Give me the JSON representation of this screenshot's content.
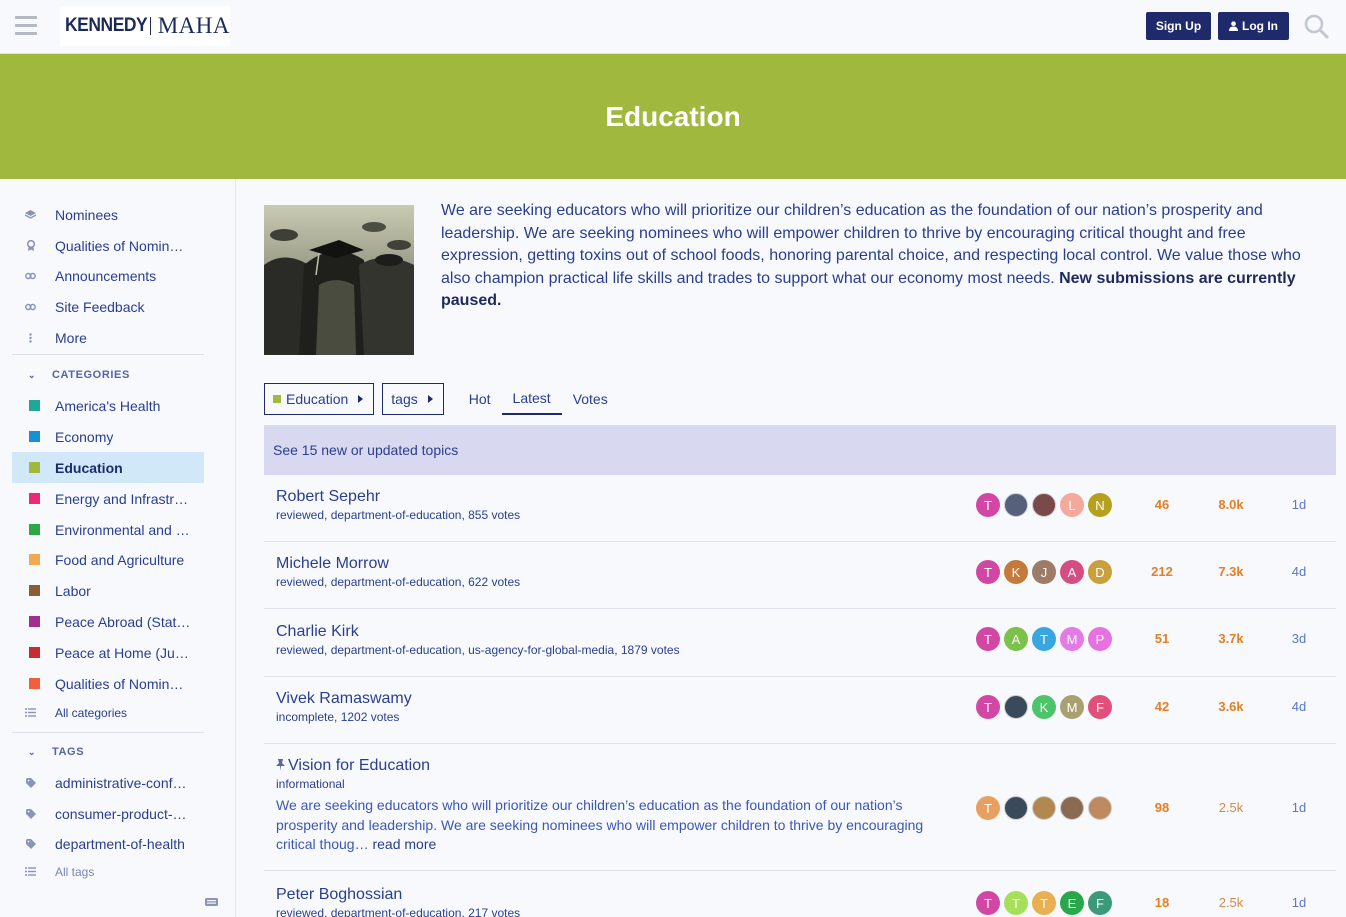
{
  "header": {
    "logo_left": "KENNEDY",
    "logo_right": "MAHA",
    "signup_label": "Sign Up",
    "login_label": "Log In"
  },
  "banner": {
    "title": "Education"
  },
  "sidebar": {
    "top_items": [
      {
        "label": "Nominees",
        "icon": "layers-icon"
      },
      {
        "label": "Qualities of Nominees",
        "icon": "award-icon"
      },
      {
        "label": "Announcements",
        "icon": "link-icon"
      },
      {
        "label": "Site Feedback",
        "icon": "link-icon"
      },
      {
        "label": "More",
        "icon": "ellipsis-icon"
      }
    ],
    "categories_heading": "CATEGORIES",
    "categories": [
      {
        "label": "America's Health",
        "color": "#1fa89a"
      },
      {
        "label": "Economy",
        "color": "#1a8fd4"
      },
      {
        "label": "Education",
        "color": "#a0b83e"
      },
      {
        "label": "Energy and Infrastructure",
        "color": "#ec2a77"
      },
      {
        "label": "Environmental and Natural Resources",
        "color": "#2aa84a"
      },
      {
        "label": "Food and Agriculture",
        "color": "#f2a954"
      },
      {
        "label": "Labor",
        "color": "#8a5e35"
      },
      {
        "label": "Peace Abroad (State, Defense)",
        "color": "#a0308e"
      },
      {
        "label": "Peace at Home (Justice, Homeland)",
        "color": "#c22e34"
      },
      {
        "label": "Qualities of Nominees",
        "color": "#f0603c"
      }
    ],
    "all_categories": "All categories",
    "tags_heading": "TAGS",
    "tags": [
      {
        "label": "administrative-conference"
      },
      {
        "label": "consumer-product-safety"
      },
      {
        "label": "department-of-health"
      }
    ],
    "all_tags": "All tags"
  },
  "category": {
    "description": "We are seeking educators who will prioritize our children’s education as the foundation of our nation’s prosperity and leadership. We are seeking nominees who will empower children to thrive by encouraging critical thought and free expression, getting toxins out of school foods, honoring parental choice, and respecting local control. We value those who also champion practical life skills and trades to support what our economy most needs.",
    "description_bold": "New submissions are currently paused."
  },
  "controls": {
    "category_filter": "Education",
    "tags_filter": "tags",
    "tabs": [
      "Hot",
      "Latest",
      "Votes"
    ],
    "active_tab": "Latest"
  },
  "new_topics": "See 15 new or updated topics",
  "topics": [
    {
      "title": "Robert Sepehr",
      "tags": [
        "reviewed",
        "department-of-education",
        "855 votes"
      ],
      "posters": [
        {
          "l": "T",
          "c": "#d147a3"
        },
        {
          "l": "",
          "c": "photo"
        },
        {
          "l": "",
          "c": "photo"
        },
        {
          "l": "L",
          "c": "#f5a99b"
        },
        {
          "l": "N",
          "c": "#b5a11e"
        }
      ],
      "replies": "46",
      "views": "8.0k",
      "activity": "1d"
    },
    {
      "title": "Michele Morrow",
      "tags": [
        "reviewed",
        "department-of-education",
        "622 votes"
      ],
      "posters": [
        {
          "l": "T",
          "c": "#d147a3"
        },
        {
          "l": "K",
          "c": "#c47a3a"
        },
        {
          "l": "J",
          "c": "#9e7b66"
        },
        {
          "l": "A",
          "c": "#d64d84"
        },
        {
          "l": "D",
          "c": "#c9a03c"
        }
      ],
      "replies": "212",
      "views": "7.3k",
      "activity": "4d"
    },
    {
      "title": "Charlie Kirk",
      "tags": [
        "reviewed",
        "department-of-education",
        "us-agency-for-global-media",
        "1879 votes"
      ],
      "posters": [
        {
          "l": "T",
          "c": "#d147a3"
        },
        {
          "l": "A",
          "c": "#7cc14a"
        },
        {
          "l": "T",
          "c": "#3aa6e0"
        },
        {
          "l": "M",
          "c": "#e37ae6"
        },
        {
          "l": "P",
          "c": "#e672e0"
        }
      ],
      "replies": "51",
      "views": "3.7k",
      "activity": "3d"
    },
    {
      "title": "Vivek Ramaswamy",
      "tags": [
        "incomplete",
        "1202 votes"
      ],
      "posters": [
        {
          "l": "T",
          "c": "#d147a3"
        },
        {
          "l": "",
          "c": "photo"
        },
        {
          "l": "K",
          "c": "#4cc46a"
        },
        {
          "l": "M",
          "c": "#a8a070"
        },
        {
          "l": "F",
          "c": "#e0507a"
        }
      ],
      "replies": "42",
      "views": "3.6k",
      "activity": "4d"
    },
    {
      "title": "Vision for Education",
      "pinned": true,
      "tags": [
        "informational"
      ],
      "excerpt": "We are seeking educators who will prioritize our children’s education as the foundation of our nation’s prosperity and leadership. We are seeking nominees who will empower children to thrive by encouraging critical thoug…",
      "read_more": "read more",
      "posters": [
        {
          "l": "T",
          "c": "#e8a060"
        },
        {
          "l": "",
          "c": "photo"
        },
        {
          "l": "",
          "c": "photo"
        },
        {
          "l": "",
          "c": "photo"
        },
        {
          "l": "",
          "c": "photo"
        }
      ],
      "replies": "98",
      "views": "2.5k",
      "activity": "1d"
    },
    {
      "title": "Peter Boghossian",
      "tags": [
        "reviewed",
        "department-of-education",
        "217 votes"
      ],
      "posters": [
        {
          "l": "T",
          "c": "#d147a3"
        },
        {
          "l": "T",
          "c": "#a6e05a"
        },
        {
          "l": "T",
          "c": "#e8b050"
        },
        {
          "l": "E",
          "c": "#28a84a"
        },
        {
          "l": "F",
          "c": "#3a9a7a"
        }
      ],
      "replies": "18",
      "views": "2.5k",
      "activity": "1d"
    }
  ]
}
